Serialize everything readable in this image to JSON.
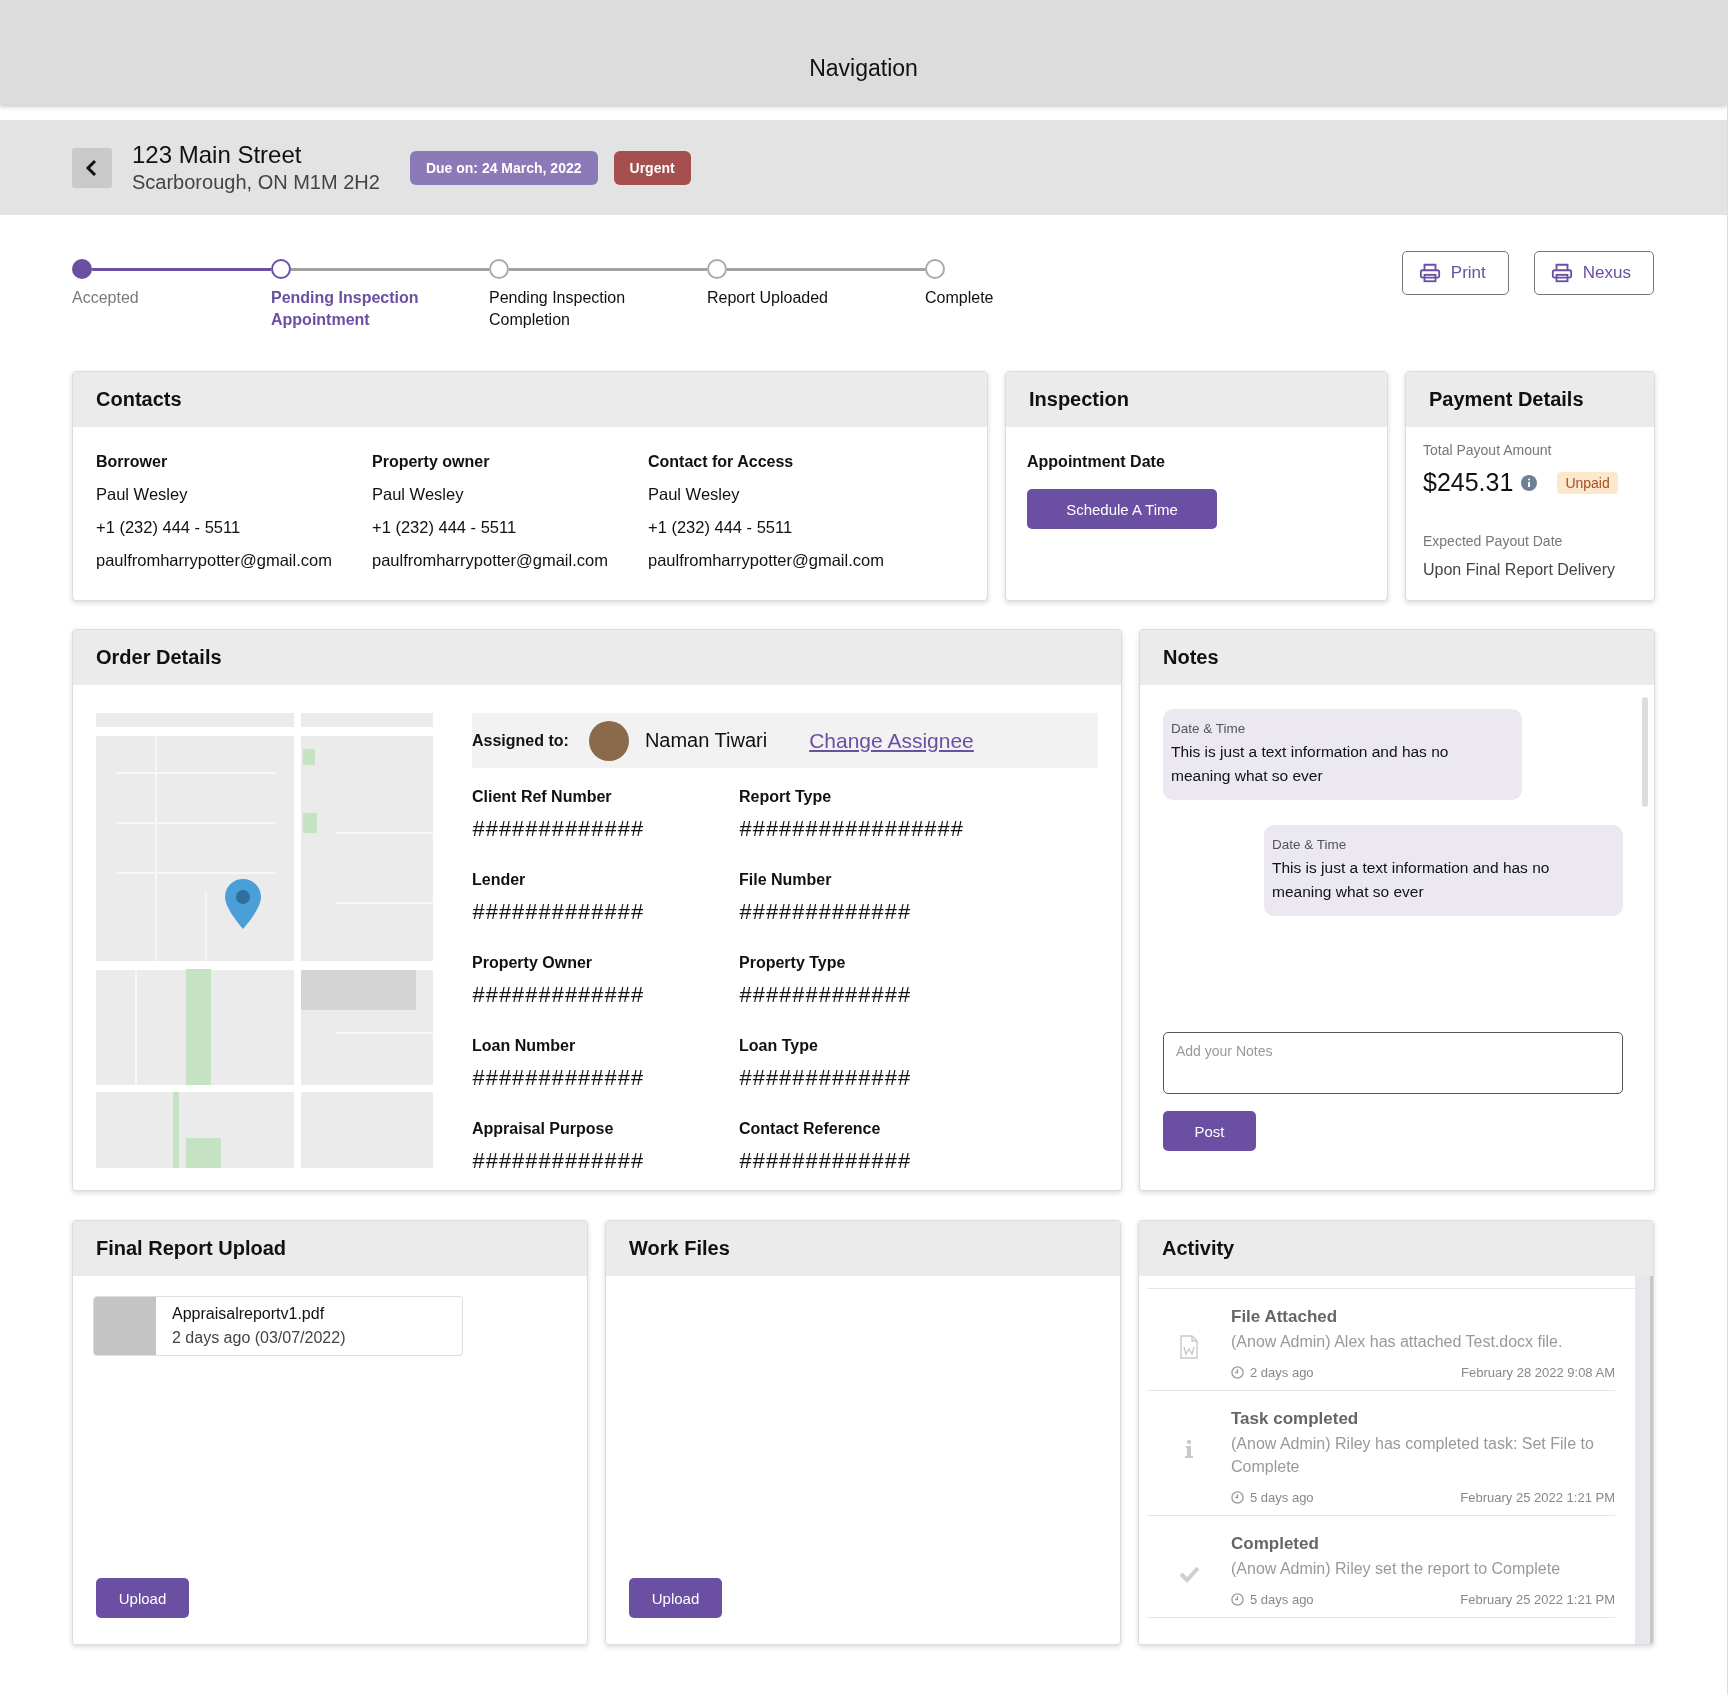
{
  "navigation": {
    "title": "Navigation"
  },
  "header": {
    "street": "123 Main Street",
    "city": "Scarborough, ON M1M 2H2",
    "badges": [
      {
        "text": "Due on: 24 March, 2022",
        "color": "#8c7ab8"
      },
      {
        "text": "Urgent",
        "color": "#a64f4f"
      }
    ]
  },
  "stepper": [
    {
      "label": "Accepted",
      "completed": true,
      "selected": false
    },
    {
      "label": "Pending Inspection Appointment",
      "completed": false,
      "selected": true
    },
    {
      "label": "Pending Inspection Completion",
      "completed": false,
      "selected": false
    },
    {
      "label": "Report Uploaded",
      "completed": false,
      "selected": false
    },
    {
      "label": "Complete",
      "completed": false,
      "selected": false
    }
  ],
  "actions": [
    {
      "label": "Print"
    },
    {
      "label": "Nexus"
    }
  ],
  "contacts": {
    "title": "Contacts",
    "columns": [
      {
        "role": "Borrower",
        "name": "Paul Wesley",
        "phone": "+1 (232) 444 - 5511",
        "email": "paulfromharrypotter@gmail.com"
      },
      {
        "role": "Property owner",
        "name": "Paul Wesley",
        "phone": "+1 (232) 444 - 5511",
        "email": "paulfromharrypotter@gmail.com"
      },
      {
        "role": "Contact for Access",
        "name": "Paul Wesley",
        "phone": "+1 (232) 444 - 5511",
        "email": "paulfromharrypotter@gmail.com"
      }
    ]
  },
  "inspection": {
    "title": "Inspection",
    "label": "Appointment Date",
    "button": "Schedule A Time"
  },
  "payment": {
    "title": "Payment Details",
    "amount_label": "Total Payout Amount",
    "amount": "$245.31",
    "status": "Unpaid",
    "date_label": "Expected Payout Date",
    "date": "Upon Final Report Delivery"
  },
  "order_details": {
    "title": "Order Details",
    "assigned_label": "Assigned to:",
    "assignee": "Naman Tiwari",
    "change_link": "Change Assignee",
    "fields": [
      {
        "label": "Client Ref Number",
        "value": "#############"
      },
      {
        "label": "Report Type",
        "value": "#################"
      },
      {
        "label": "Lender",
        "value": "#############"
      },
      {
        "label": "File Number",
        "value": "#############"
      },
      {
        "label": "Property Owner",
        "value": "#############"
      },
      {
        "label": "Property Type",
        "value": "#############"
      },
      {
        "label": "Loan Number",
        "value": "#############"
      },
      {
        "label": "Loan Type",
        "value": "#############"
      },
      {
        "label": "Appraisal Purpose",
        "value": "#############"
      },
      {
        "label": "Contact Reference",
        "value": "#############"
      }
    ]
  },
  "notes": {
    "title": "Notes",
    "messages": [
      {
        "kind": "received",
        "meta": "Date & Time",
        "text": "This is just a text information and has no meaning what so ever"
      },
      {
        "kind": "sent",
        "meta": "Date & Time",
        "text": "This is just a text information and has no meaning what so ever"
      }
    ],
    "placeholder": "Add your Notes",
    "button": "Post"
  },
  "final_report": {
    "title": "Final Report Upload",
    "files": [
      {
        "name": "Appraisalreportv1.pdf",
        "date": "2 days ago (03/07/2022)"
      }
    ],
    "button": "Upload"
  },
  "work_files": {
    "title": "Work Files",
    "button": "Upload"
  },
  "activity": {
    "title": "Activity",
    "items": [
      {
        "kind": "file",
        "title": "File Attached",
        "text": "(Anow Admin) Alex has attached Test.docx file.",
        "ago": "2 days ago",
        "date": "February 28 2022 9:08 AM"
      },
      {
        "kind": "info",
        "title": "Task completed",
        "text": "(Anow Admin) Riley has completed task: Set File to Complete",
        "ago": "5 days ago",
        "date": "February 25 2022 1:21 PM"
      },
      {
        "kind": "done",
        "title": "Completed",
        "text": "(Anow Admin) Riley set the report to Complete",
        "ago": "5 days ago",
        "date": "February 25 2022 1:21 PM"
      }
    ]
  }
}
